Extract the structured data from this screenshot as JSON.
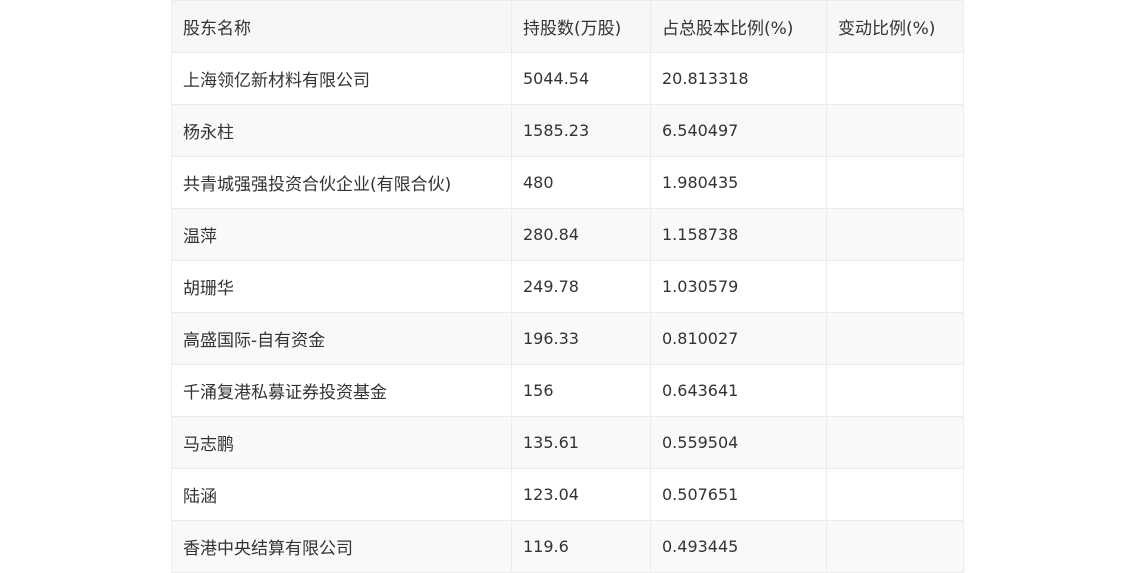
{
  "table": {
    "headers": [
      "股东名称",
      "持股数(万股)",
      "占总股本比例(%)",
      "变动比例(%)"
    ],
    "rows": [
      {
        "name": "上海领亿新材料有限公司",
        "shares": "5044.54",
        "ratio": "20.813318",
        "change": ""
      },
      {
        "name": "杨永柱",
        "shares": "1585.23",
        "ratio": "6.540497",
        "change": ""
      },
      {
        "name": "共青城强强投资合伙企业(有限合伙)",
        "shares": "480",
        "ratio": "1.980435",
        "change": ""
      },
      {
        "name": "温萍",
        "shares": "280.84",
        "ratio": "1.158738",
        "change": ""
      },
      {
        "name": "胡珊华",
        "shares": "249.78",
        "ratio": "1.030579",
        "change": ""
      },
      {
        "name": "高盛国际-自有资金",
        "shares": "196.33",
        "ratio": "0.810027",
        "change": ""
      },
      {
        "name": "千涌复港私募证券投资基金",
        "shares": "156",
        "ratio": "0.643641",
        "change": ""
      },
      {
        "name": "马志鹏",
        "shares": "135.61",
        "ratio": "0.559504",
        "change": ""
      },
      {
        "name": "陆涵",
        "shares": "123.04",
        "ratio": "0.507651",
        "change": ""
      },
      {
        "name": "香港中央结算有限公司",
        "shares": "119.6",
        "ratio": "0.493445",
        "change": ""
      }
    ]
  }
}
